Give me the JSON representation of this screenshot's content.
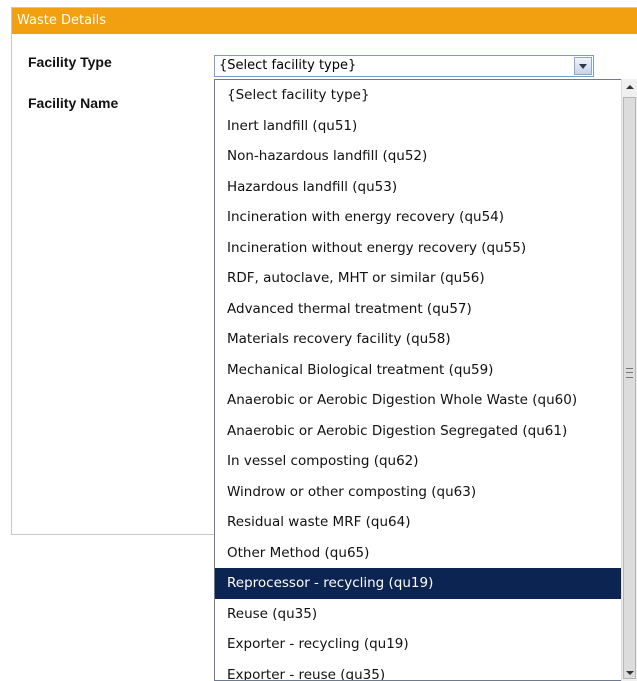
{
  "panel": {
    "title": "Waste Details",
    "header_color": "#f29f10"
  },
  "form": {
    "facility_type_label": "Facility Type",
    "facility_name_label": "Facility Name",
    "facility_type_value": "{Select facility type}"
  },
  "dropdown": {
    "selected_color": "#0c2452",
    "options": [
      "{Select facility type}",
      "Inert landfill (qu51)",
      "Non-hazardous landfill (qu52)",
      "Hazardous landfill (qu53)",
      "Incineration with energy recovery (qu54)",
      "Incineration without energy recovery (qu55)",
      "RDF, autoclave, MHT or similar (qu56)",
      "Advanced thermal treatment (qu57)",
      "Materials recovery facility (qu58)",
      "Mechanical Biological treatment (qu59)",
      "Anaerobic or Aerobic Digestion Whole Waste (qu60)",
      "Anaerobic or Aerobic Digestion Segregated (qu61)",
      "In vessel composting (qu62)",
      "Windrow or other composting (qu63)",
      "Residual waste MRF (qu64)",
      "Other Method (qu65)",
      "Reprocessor - recycling (qu19)",
      "Reuse (qu35)",
      "Exporter - recycling (qu19)",
      "Exporter - reuse (qu35)"
    ],
    "highlighted": "Reprocessor - recycling (qu19)"
  }
}
